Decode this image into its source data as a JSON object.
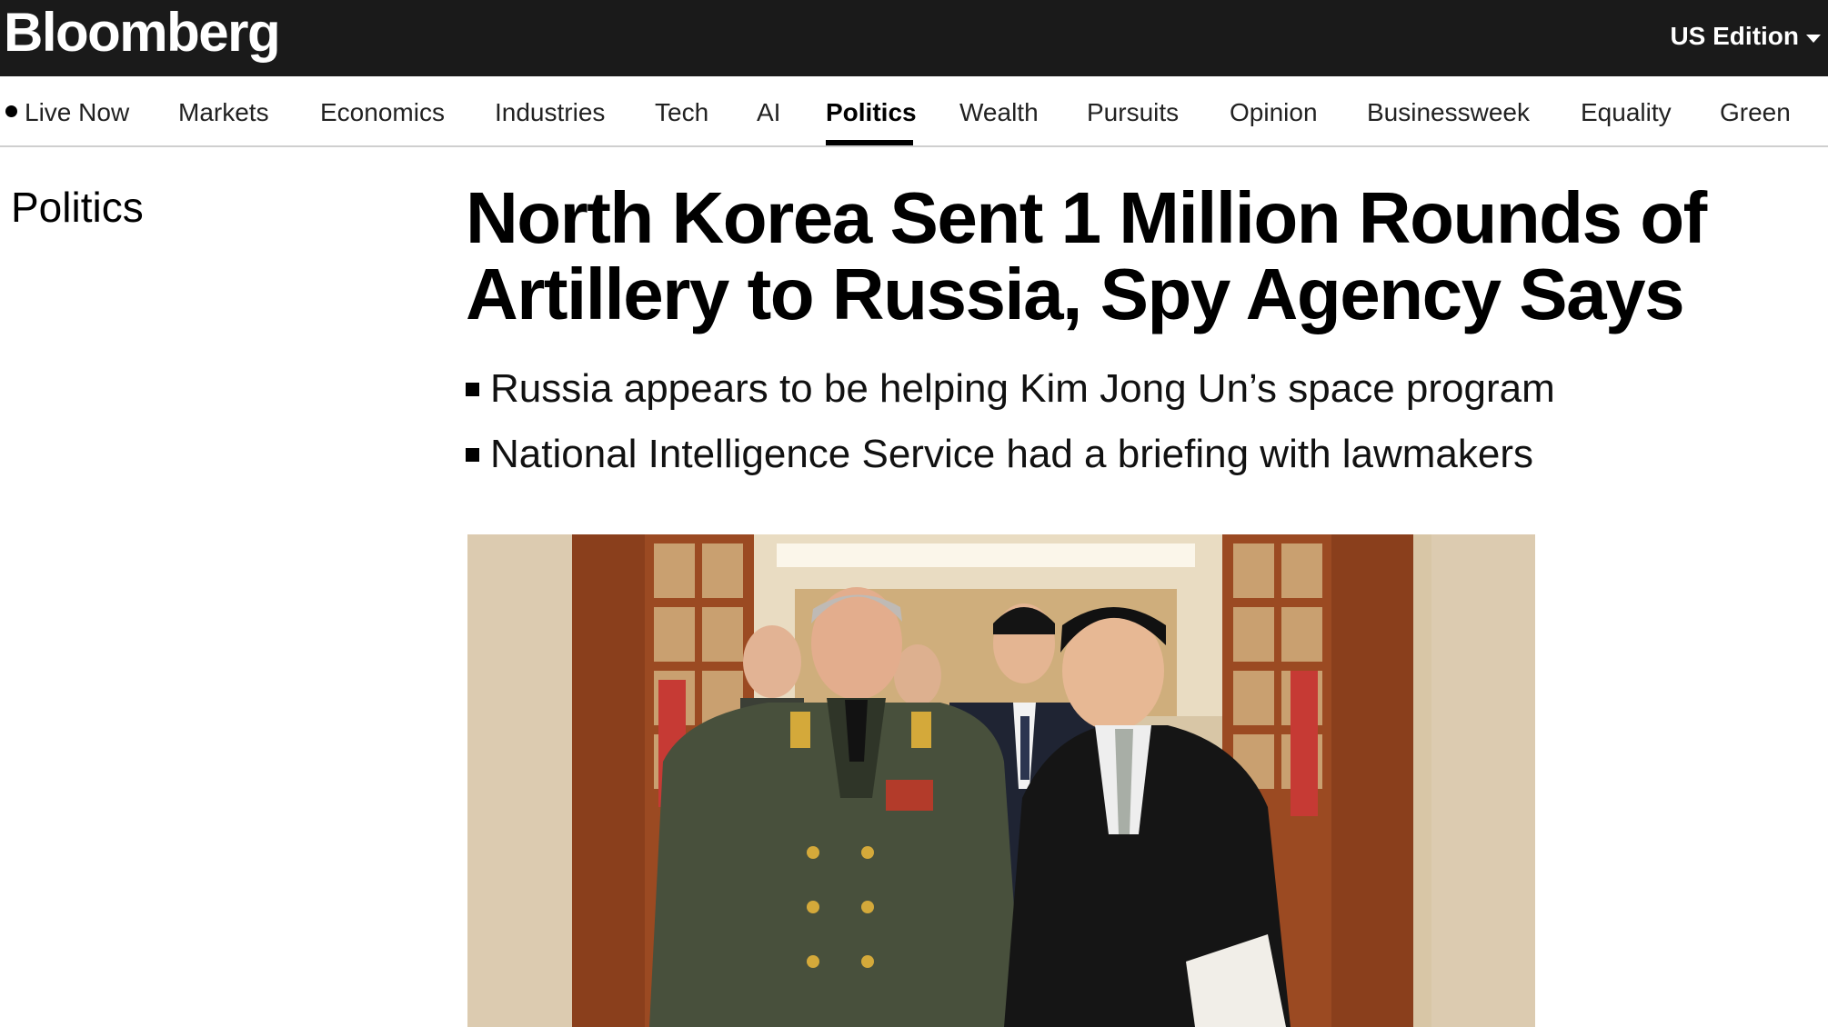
{
  "header": {
    "logo": "Bloomberg",
    "edition_label": "US Edition",
    "edition_icon": "chevron-down-icon",
    "background_color": "#1a1a1a"
  },
  "nav": {
    "items": [
      {
        "label": "Live Now",
        "active": false,
        "icon": "live-dot-icon"
      },
      {
        "label": "Markets",
        "active": false
      },
      {
        "label": "Economics",
        "active": false
      },
      {
        "label": "Industries",
        "active": false
      },
      {
        "label": "Tech",
        "active": false
      },
      {
        "label": "AI",
        "active": false
      },
      {
        "label": "Politics",
        "active": true
      },
      {
        "label": "Wealth",
        "active": false
      },
      {
        "label": "Pursuits",
        "active": false
      },
      {
        "label": "Opinion",
        "active": false
      },
      {
        "label": "Businessweek",
        "active": false
      },
      {
        "label": "Equality",
        "active": false
      },
      {
        "label": "Green",
        "active": false
      }
    ]
  },
  "article": {
    "section": "Politics",
    "headline_line1": "North Korea Sent 1 Million Rounds of",
    "headline_line2": "Artillery to Russia, Spy Agency Says",
    "bullets": [
      "Russia appears to be helping Kim Jong Un’s space program",
      "National Intelligence Service had a briefing with lawmakers"
    ],
    "image": {
      "subject": "photo-military-officer-and-leader-walking-in-hallway"
    }
  }
}
